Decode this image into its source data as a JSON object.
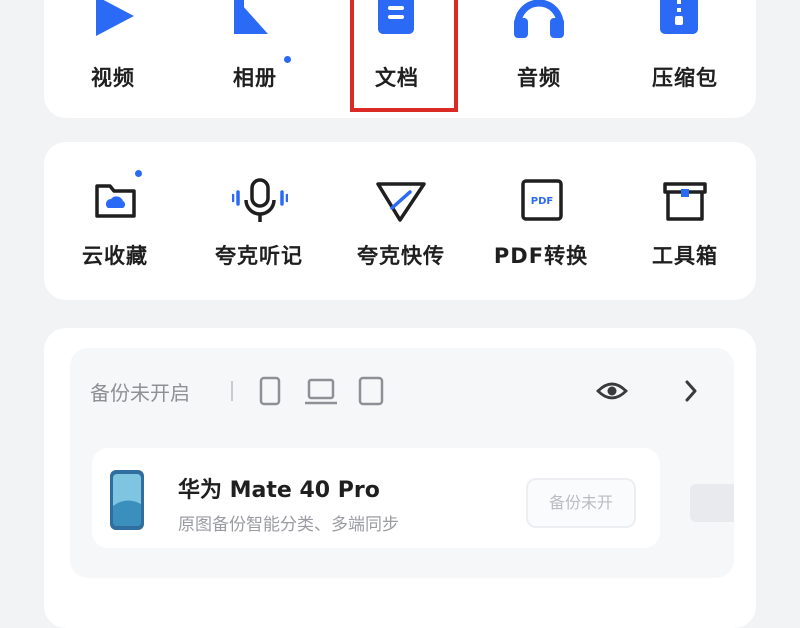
{
  "top_row": [
    {
      "label": "视频",
      "icon": "play-icon"
    },
    {
      "label": "相册",
      "icon": "album-icon"
    },
    {
      "label": "文档",
      "icon": "document-icon"
    },
    {
      "label": "音频",
      "icon": "headphones-icon"
    },
    {
      "label": "压缩包",
      "icon": "zip-icon"
    }
  ],
  "tools_row": [
    {
      "label": "云收藏",
      "icon": "cloud-folder-icon"
    },
    {
      "label": "夸克听记",
      "icon": "microphone-icon"
    },
    {
      "label": "夸克快传",
      "icon": "send-icon"
    },
    {
      "label": "PDF转换",
      "icon": "pdf-icon"
    },
    {
      "label": "工具箱",
      "icon": "toolbox-icon"
    }
  ],
  "backup": {
    "status": "备份未开启",
    "device_name": "华为 Mate 40 Pro",
    "device_desc": "原图备份智能分类、多端同步",
    "button_label": "备份未开"
  },
  "colors": {
    "accent": "#2b6af5",
    "highlight": "#d92a23"
  }
}
